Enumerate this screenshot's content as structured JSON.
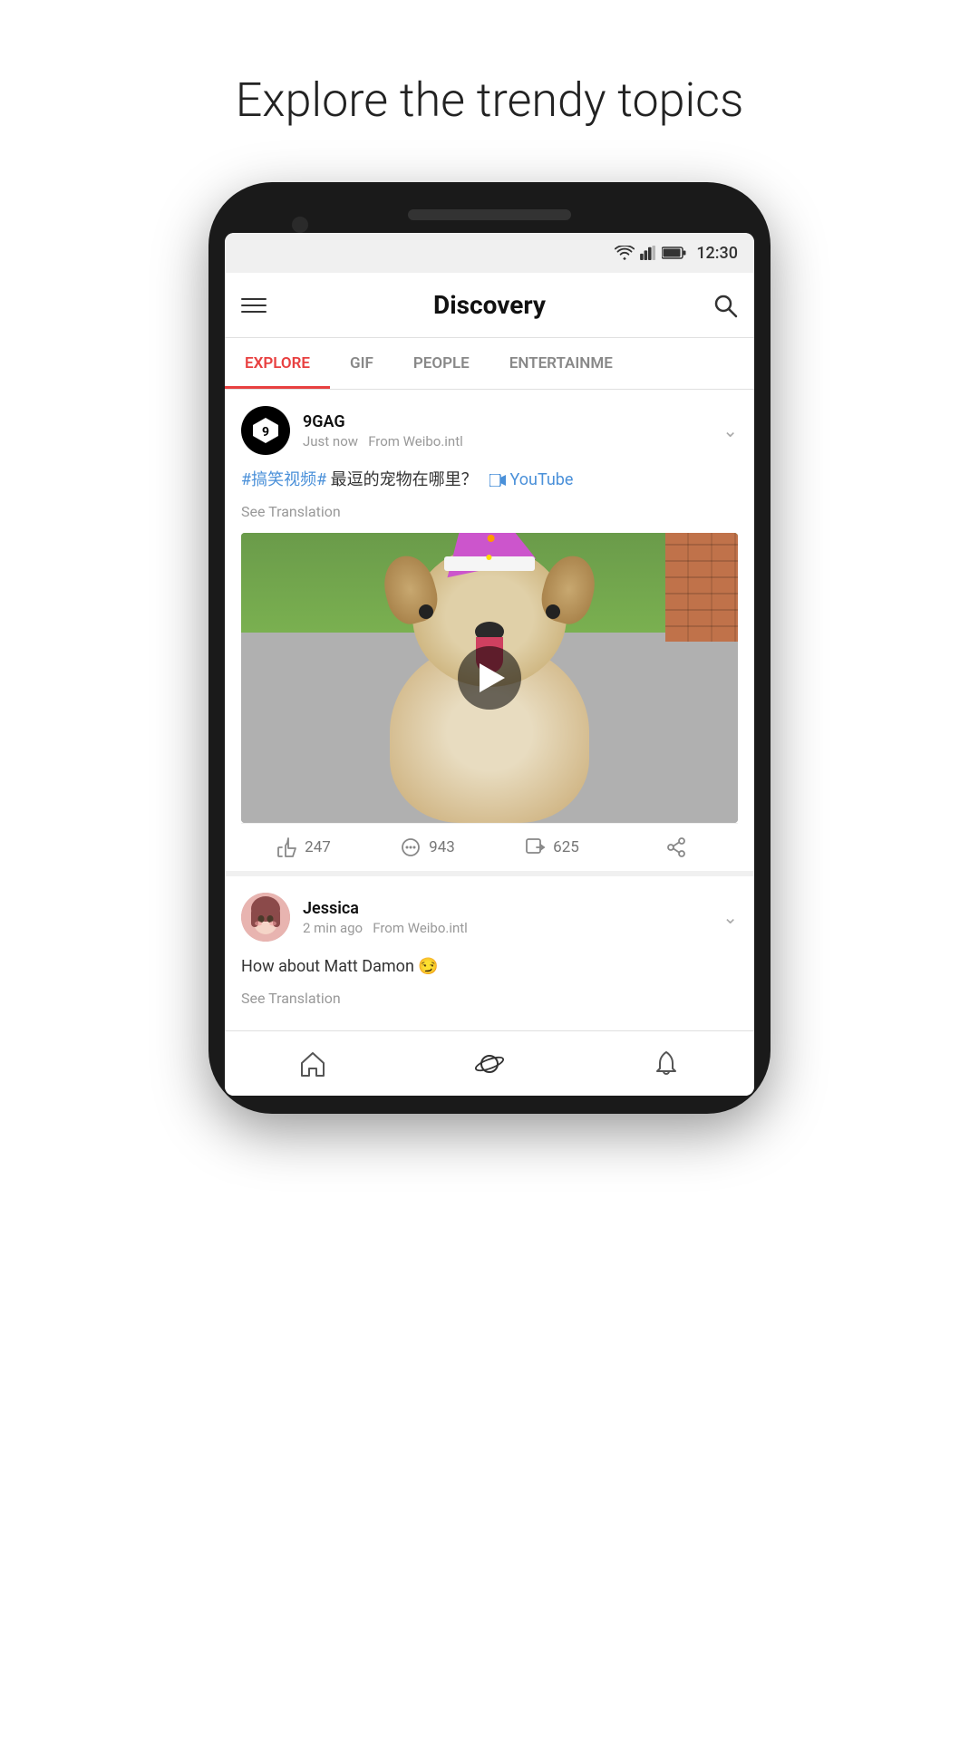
{
  "page": {
    "title": "Explore the trendy topics"
  },
  "statusBar": {
    "time": "12:30"
  },
  "header": {
    "title": "Discovery",
    "searchLabel": "search"
  },
  "tabs": [
    {
      "label": "EXPLORE",
      "active": true
    },
    {
      "label": "GIF",
      "active": false
    },
    {
      "label": "PEOPLE",
      "active": false
    },
    {
      "label": "ENTERTAINME",
      "active": false
    }
  ],
  "posts": [
    {
      "author": "9GAG",
      "time": "Just now",
      "source": "From Weibo.intl",
      "text_hashtag": "#搞笑视频#",
      "text_body": " 最逗的宠物在哪里？",
      "youtube_label": "YouTube",
      "see_translation": "See Translation",
      "likes": "247",
      "comments": "943",
      "shares": "625"
    },
    {
      "author": "Jessica",
      "time": "2 min ago",
      "source": "From Weibo.intl",
      "text": "How about Matt Damon 😏",
      "see_translation": "See Translation"
    }
  ],
  "bottomNav": [
    {
      "label": "home",
      "icon": "home"
    },
    {
      "label": "discover",
      "icon": "planet",
      "active": true
    },
    {
      "label": "notifications",
      "icon": "bell"
    }
  ],
  "colors": {
    "accent": "#e84040",
    "blue": "#4a90d9",
    "textDark": "#111",
    "textMid": "#555",
    "textLight": "#999"
  }
}
